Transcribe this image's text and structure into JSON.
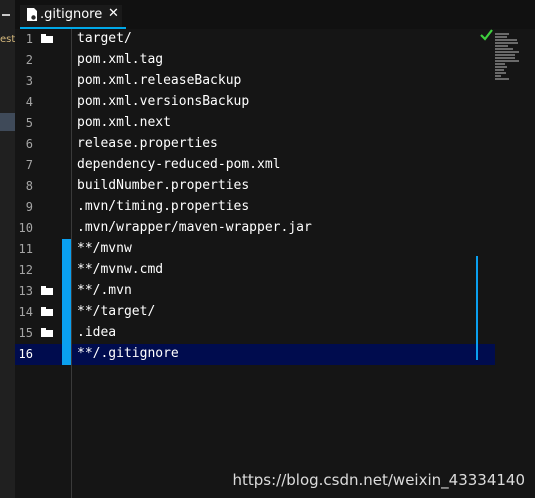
{
  "sidebar": {
    "partial_text": "est"
  },
  "tab": {
    "title": ".gitignore",
    "close": "✕"
  },
  "editor": {
    "lines": [
      {
        "num": "1",
        "text": "target/"
      },
      {
        "num": "2",
        "text": "pom.xml.tag"
      },
      {
        "num": "3",
        "text": "pom.xml.releaseBackup"
      },
      {
        "num": "4",
        "text": "pom.xml.versionsBackup"
      },
      {
        "num": "5",
        "text": "pom.xml.next"
      },
      {
        "num": "6",
        "text": "release.properties"
      },
      {
        "num": "7",
        "text": "dependency-reduced-pom.xml"
      },
      {
        "num": "8",
        "text": "buildNumber.properties"
      },
      {
        "num": "9",
        "text": ".mvn/timing.properties"
      },
      {
        "num": "10",
        "text": ".mvn/wrapper/maven-wrapper.jar"
      },
      {
        "num": "11",
        "text": "**/mvnw"
      },
      {
        "num": "12",
        "text": "**/mvnw.cmd"
      },
      {
        "num": "13",
        "text": "**/.mvn"
      },
      {
        "num": "14",
        "text": "**/target/"
      },
      {
        "num": "15",
        "text": ".idea"
      },
      {
        "num": "16",
        "text": "**/.gitignore"
      }
    ],
    "current_line": 16,
    "folder_icon_lines": [
      1,
      13,
      14,
      15
    ],
    "status_icon": "check-icon"
  },
  "watermark": "https://blog.csdn.net/weixin_43334140",
  "colors": {
    "accent": "#00a8e8",
    "change_bar": "#0aa0f0",
    "current_line_bg": "#000c4e",
    "check": "#3ecf3e"
  }
}
